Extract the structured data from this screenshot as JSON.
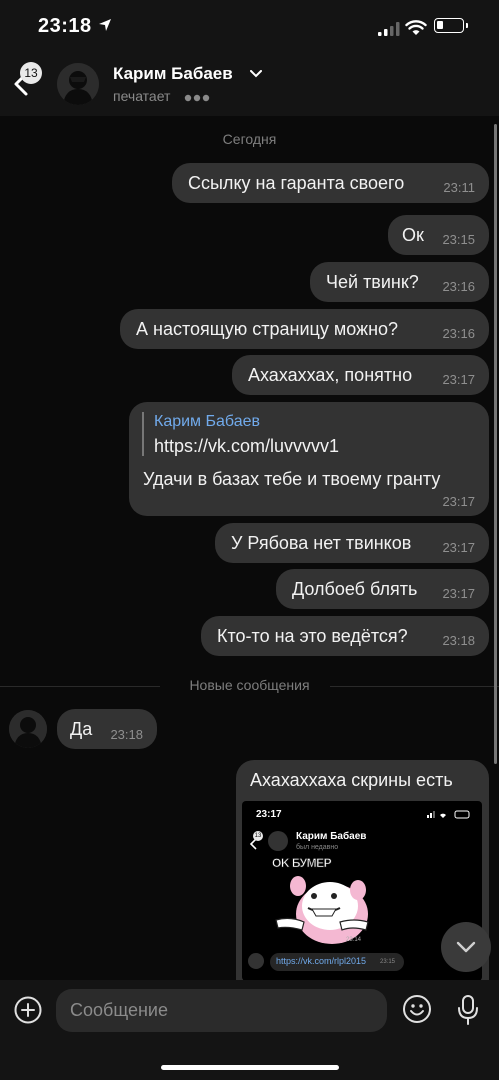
{
  "status_bar": {
    "time": "23:18"
  },
  "header": {
    "unread_count": "13",
    "contact_name": "Карим Бабаев",
    "status": "печатает"
  },
  "chat": {
    "date_separator": "Сегодня",
    "outgoing_1": {
      "text": "Ссылку на гаранта своего",
      "time": "23:11"
    },
    "outgoing_2": {
      "text": "Ок",
      "time": "23:15"
    },
    "outgoing_3": {
      "text": "Чей твинк?",
      "time": "23:16"
    },
    "outgoing_4": {
      "text": "А настоящую страницу можно?",
      "time": "23:16"
    },
    "outgoing_5": {
      "text": "Ахахаххах, понятно",
      "time": "23:17"
    },
    "outgoing_6": {
      "quote_author": "Карим Бабаев",
      "quote_text": "https://vk.com/luvvvvv1",
      "text": "Удачи в базах тебе и твоему гранту",
      "time": "23:17"
    },
    "outgoing_7": {
      "text": "У Рябова нет твинков",
      "time": "23:17"
    },
    "outgoing_8": {
      "text": "Долбоеб блять",
      "time": "23:17"
    },
    "outgoing_9": {
      "text": "Кто-то на это ведётся?",
      "time": "23:18"
    },
    "new_messages_separator": "Новые сообщения",
    "incoming_1": {
      "text": "Да",
      "time": "23:18"
    },
    "outgoing_10": {
      "text": "Ахахаххаха скрины есть",
      "screenshot": {
        "time": "23:17",
        "badge": "13",
        "name": "Карим Бабаев",
        "status": "был недавно",
        "sticker_text": "OK БУМЕР",
        "sticker_time": "23:14",
        "link": "https://vk.com/rlpl2015",
        "link_time": "23:15"
      }
    }
  },
  "input": {
    "placeholder": "Сообщение"
  },
  "colors": {
    "bubble": "#333333",
    "background": "#0a0a0a",
    "quote_author": "#71aaeb"
  }
}
